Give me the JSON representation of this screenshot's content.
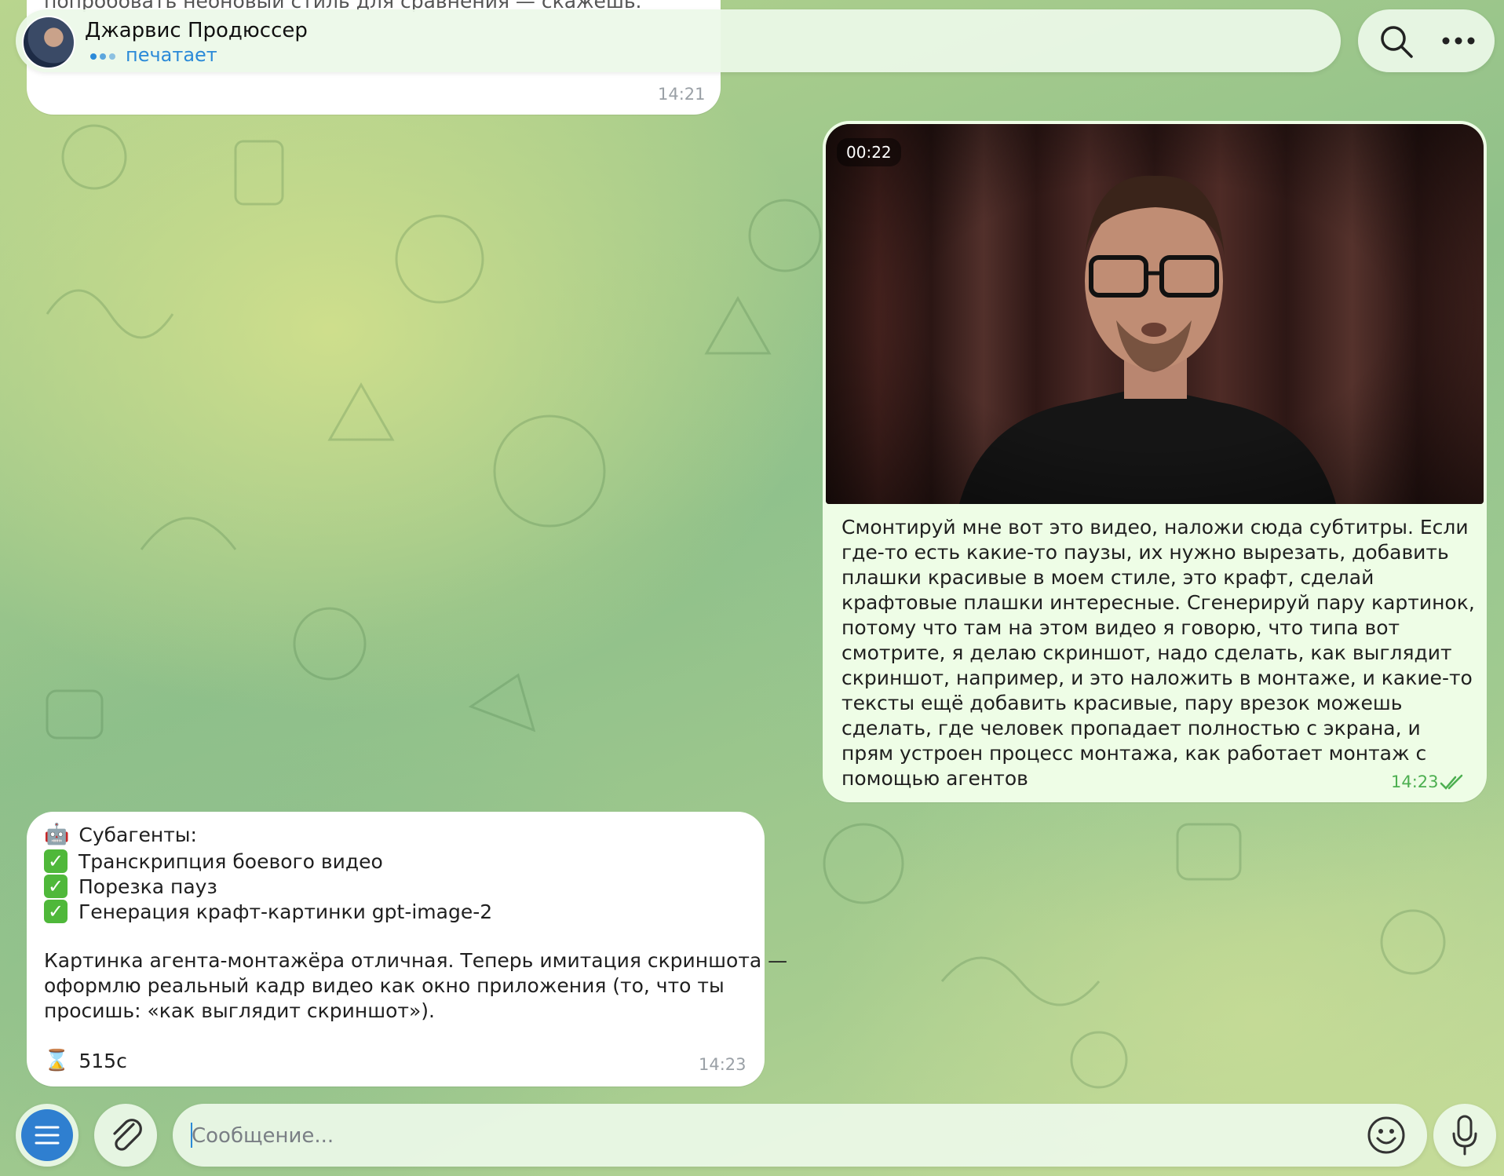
{
  "header": {
    "contact_name": "Джарвис Продюссер",
    "status": "печатает",
    "icons": [
      "search-icon",
      "more-icon"
    ]
  },
  "messages": {
    "top_partial": {
      "text": "попробовать неоновый стиль для сравнения — скажешь.",
      "time": "14:21"
    },
    "outgoing": {
      "video_duration": "00:22",
      "text": "Смонтируй мне вот это видео, наложи сюда субтитры. Если\nгде-то есть какие-то паузы, их нужно вырезать, добавить\nплашки красивые в моем стиле, это крафт, сделай\nкрафтовые плашки интересные. Сгенерируй пару картинок,\nпотому что там на этом видео я говорю, что типа вот\nсмотрите, я делаю скриншот, надо сделать, как выглядит\nскриншот, например, и это наложить в монтаже, и какие-то\nтексты ещё добавить красивые, пару врезок можешь\nсделать, где человек пропадает полностью с экрана, и\nпрям устроен процесс монтажа, как работает монтаж с\nпомощью агентов",
      "time": "14:23"
    },
    "incoming": {
      "subagents_title": "Субагенты:",
      "tasks": [
        "Транскрипция боевого видео",
        "Порезка пауз",
        "Генерация крафт-картинки gpt-image-2"
      ],
      "body": "Картинка агента-монтажёра отличная. Теперь имитация скриншота —\nоформлю реальный кадр видео как окно приложения (то, что ты\nпросишь: «как выглядит скриншот»).",
      "elapsed": "515с",
      "time": "14:23"
    }
  },
  "composer": {
    "placeholder": "Сообщение..."
  },
  "colors": {
    "accent": "#2b8ad8",
    "menu_button": "#2f7fd0",
    "outgoing_bubble": "#eefde6",
    "incoming_bubble": "#ffffff",
    "read_check": "#4caf50"
  }
}
